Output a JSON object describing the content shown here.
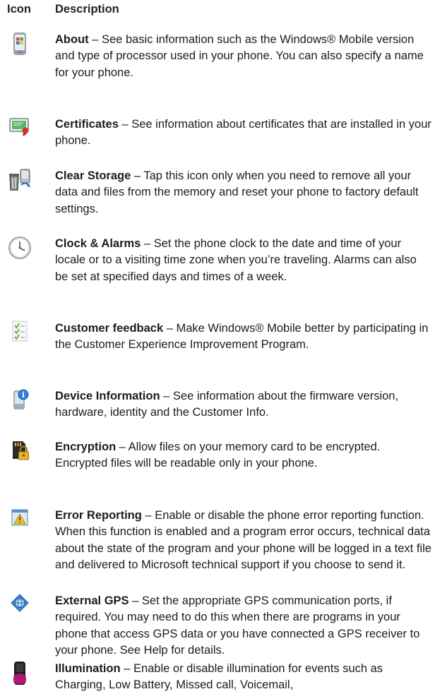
{
  "header": {
    "icon": "Icon",
    "description": "Description"
  },
  "items": [
    {
      "title": "About",
      "text": " – See basic information such as the Windows® Mobile version and type of processor used in your phone. You can also specify a name for your phone.",
      "icon": "phone-windows-logo-icon"
    },
    {
      "title": "Certificates",
      "text": " – See information about certificates that are installed in your phone.",
      "icon": "certificate-icon"
    },
    {
      "title": "Clear Storage",
      "text": " – Tap this icon only when you need to remove all your data and files from the memory and reset your phone to factory default settings.",
      "icon": "clear-storage-trash-icon"
    },
    {
      "title": "Clock & Alarms",
      "text": " – Set the phone clock to the date and time of your locale or to a visiting time zone when you’re traveling. Alarms can also be set at specified days and times of a week.",
      "icon": "clock-icon"
    },
    {
      "title": "Customer feedback",
      "text": " – Make Windows® Mobile better by participating in the Customer Experience Improvement Program.",
      "icon": "checklist-icon"
    },
    {
      "title": "Device Information",
      "text": " – See information about the firmware version, hardware, identity and the Customer Info.",
      "icon": "device-info-icon"
    },
    {
      "title": "Encryption",
      "text": " – Allow files on your memory card to be encrypted. Encrypted files will be readable only in your phone.",
      "icon": "memory-card-lock-icon"
    },
    {
      "title": "Error Reporting",
      "text": " – Enable or disable the phone error reporting function. When this function is enabled and a program error occurs, technical data about the state of the program and your phone will be logged in a text file and delivered to Microsoft technical support if you choose to send it.",
      "icon": "error-warning-icon"
    },
    {
      "title": "External GPS",
      "text": " – Set the appropriate GPS communication ports, if required. You may need to do this when there are programs in your phone that access GPS data or you have connected a GPS receiver to your phone. See Help for details.",
      "icon": "gps-globe-icon"
    },
    {
      "title": "Illumination",
      "text": " – Enable or disable illumination for events such as Charging, Low Battery, Missed call, Voicemail,",
      "icon": "illumination-phone-icon"
    }
  ]
}
